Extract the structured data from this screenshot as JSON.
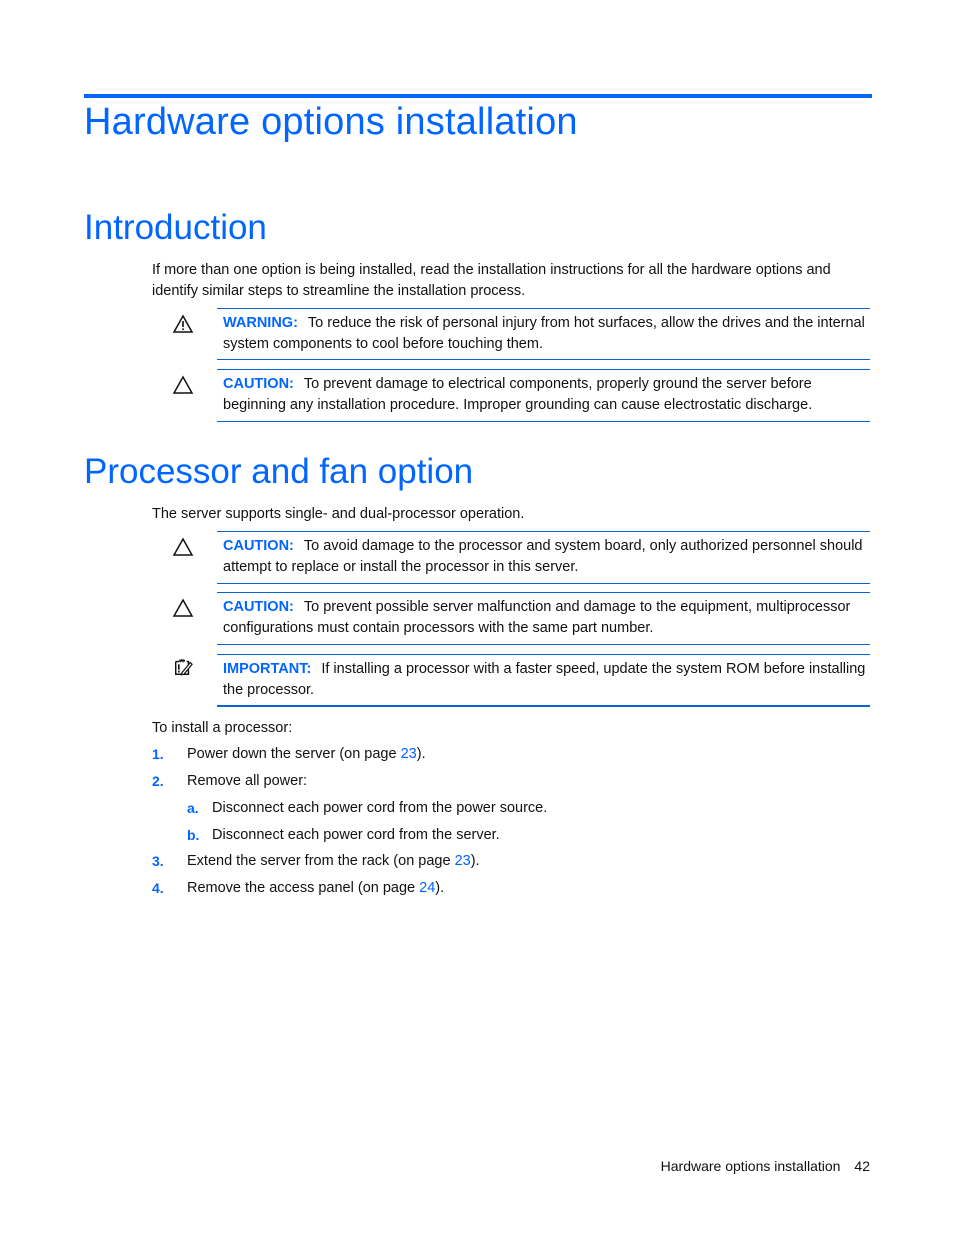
{
  "page_title": "Hardware options installation",
  "sections": {
    "introduction": {
      "heading": "Introduction",
      "paragraph": "If more than one option is being installed, read the installation instructions for all the hardware options and identify similar steps to streamline the installation process.",
      "notes": [
        {
          "type": "warning",
          "label": "WARNING:",
          "text": "To reduce the risk of personal injury from hot surfaces, allow the drives and the internal system components to cool before touching them."
        },
        {
          "type": "caution",
          "label": "CAUTION:",
          "text": "To prevent damage to electrical components, properly ground the server before beginning any installation procedure. Improper grounding can cause electrostatic discharge."
        }
      ]
    },
    "processor": {
      "heading": "Processor and fan option",
      "paragraph": "The server supports single- and dual-processor operation.",
      "notes": [
        {
          "type": "caution",
          "label": "CAUTION:",
          "text": "To avoid damage to the processor and system board, only authorized personnel should attempt to replace or install the processor in this server."
        },
        {
          "type": "caution",
          "label": "CAUTION:",
          "text": "To prevent possible server malfunction and damage to the equipment, multiprocessor configurations must contain processors with the same part number."
        },
        {
          "type": "important",
          "label": "IMPORTANT:",
          "text": "If installing a processor with a faster speed, update the system ROM before installing the processor."
        }
      ],
      "intro": "To install a processor:",
      "steps": [
        {
          "num": "1.",
          "text": "Power down the server (on page ",
          "link": "23",
          "after": ")."
        },
        {
          "num": "2.",
          "text": "Remove all power:",
          "link": "",
          "after": ""
        },
        {
          "num": "a.",
          "text": "Disconnect each power cord from the power source.",
          "link": "",
          "after": ""
        },
        {
          "num": "b.",
          "text": "Disconnect each power cord from the server.",
          "link": "",
          "after": ""
        },
        {
          "num": "3.",
          "text": "Extend the server from the rack (on page ",
          "link": "23",
          "after": ")."
        },
        {
          "num": "4.",
          "text": "Remove the access panel (on page ",
          "link": "24",
          "after": ")."
        }
      ]
    }
  },
  "footer": {
    "section": "Hardware options installation",
    "page": "42"
  },
  "colors": {
    "accent": "#0066ff"
  }
}
